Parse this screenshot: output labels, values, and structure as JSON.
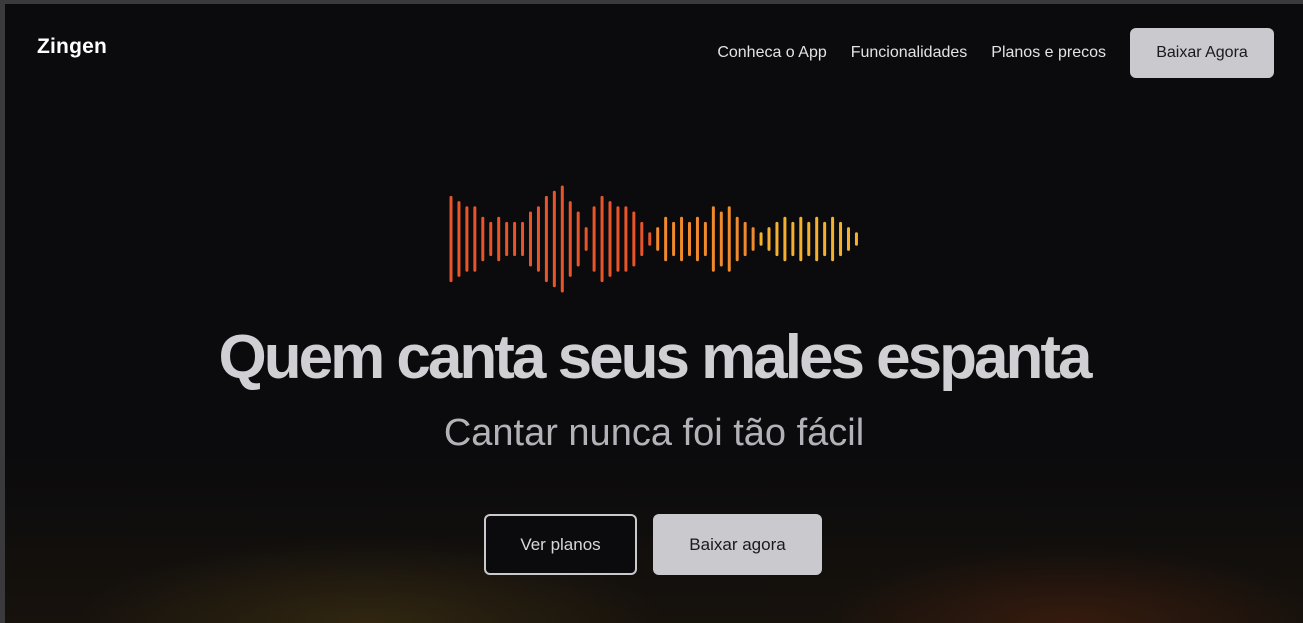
{
  "brand": {
    "name": "Zingen"
  },
  "nav": {
    "links": [
      "Conheca o App",
      "Funcionalidades",
      "Planos e precos"
    ],
    "cta_label": "Baixar Agora"
  },
  "hero": {
    "title": "Quem canta seus males espanta",
    "subtitle": "Cantar nunca foi tão fácil",
    "secondary_button": "Ver planos",
    "primary_button": "Baixar agora"
  },
  "waveform": {
    "icon": "audio-waveform-icon",
    "gradient": [
      "#e8552b",
      "#f08a2c",
      "#f5b12e"
    ],
    "levels": [
      0.8,
      0.7,
      0.6,
      0.6,
      0.4,
      0.3,
      0.4,
      0.3,
      0.3,
      0.3,
      0.5,
      0.6,
      0.8,
      0.9,
      1.0,
      0.7,
      0.5,
      0.2,
      0.6,
      0.8,
      0.7,
      0.6,
      0.6,
      0.5,
      0.3,
      0.1,
      0.2,
      0.4,
      0.3,
      0.4,
      0.3,
      0.4,
      0.3,
      0.6,
      0.5,
      0.6,
      0.4,
      0.3,
      0.2,
      0.1,
      0.2,
      0.3,
      0.4,
      0.3,
      0.4,
      0.3,
      0.4,
      0.3,
      0.4,
      0.3,
      0.2,
      0.1
    ]
  }
}
